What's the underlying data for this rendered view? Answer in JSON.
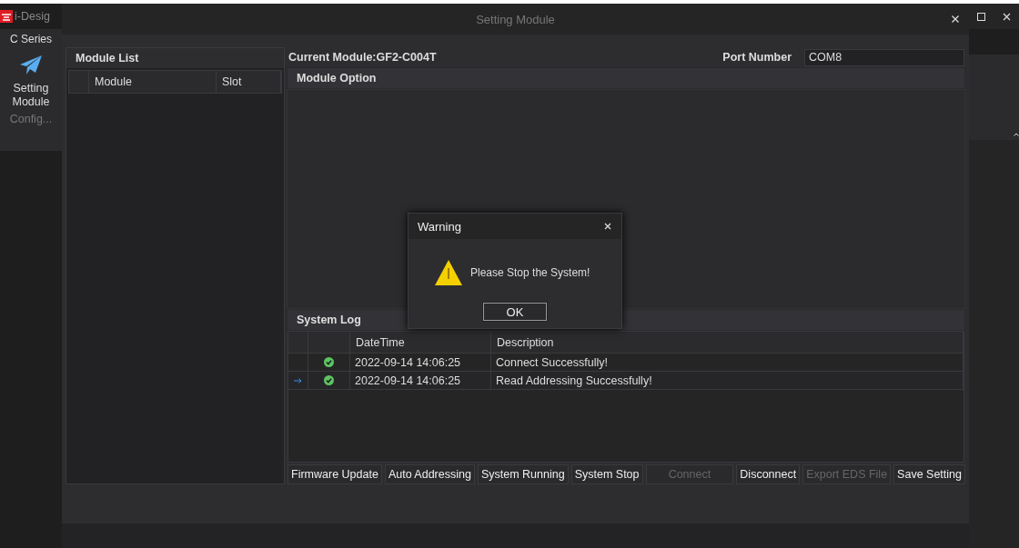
{
  "outer_window": {
    "title": "i-Desig"
  },
  "sidebar": {
    "section": "C Series",
    "items": [
      {
        "label": "Setting Module",
        "selected": true
      },
      {
        "label": "Config...",
        "selected": false
      }
    ]
  },
  "dialog": {
    "title": "Setting Module"
  },
  "module_list": {
    "title": "Module List",
    "columns": [
      "Module",
      "Slot"
    ]
  },
  "current_module": "Current Module:GF2-C004T",
  "port": {
    "label": "Port Number",
    "value": "COM8"
  },
  "module_option": {
    "title": "Module Option"
  },
  "system_log": {
    "title": "System Log",
    "columns": [
      "DateTime",
      "Description"
    ],
    "rows": [
      {
        "current": false,
        "datetime": "2022-09-14 14:06:25",
        "description": "Connect Successfully!"
      },
      {
        "current": true,
        "datetime": "2022-09-14 14:06:25",
        "description": "Read Addressing Successfully!"
      }
    ]
  },
  "buttons": [
    {
      "label": "Firmware Update",
      "disabled": false
    },
    {
      "label": "Auto Addressing",
      "disabled": false
    },
    {
      "label": "System Running",
      "disabled": false
    },
    {
      "label": "System Stop",
      "disabled": false
    },
    {
      "label": "Connect",
      "disabled": true
    },
    {
      "label": "Disconnect",
      "disabled": false
    },
    {
      "label": "Export EDS File",
      "disabled": true
    },
    {
      "label": "Save Setting",
      "disabled": false
    }
  ],
  "warning": {
    "title": "Warning",
    "message": "Please Stop the System!",
    "button": "OK"
  }
}
